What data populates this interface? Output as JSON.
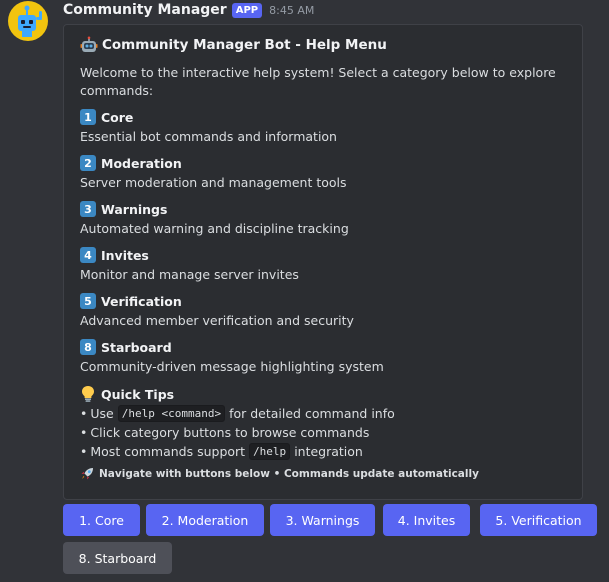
{
  "message": {
    "author": "Community Manager",
    "badge": "APP",
    "timestamp": "8:45 AM",
    "avatar_color": "#f1c40f"
  },
  "embed": {
    "title": "Community Manager Bot - Help Menu",
    "title_icon": "robot-icon",
    "description": "Welcome to the interactive help system! Select a category below to explore commands:",
    "categories": [
      {
        "key": "1",
        "name": "Core",
        "description": "Essential bot commands and information"
      },
      {
        "key": "2",
        "name": "Moderation",
        "description": "Server moderation and management tools"
      },
      {
        "key": "3",
        "name": "Warnings",
        "description": "Automated warning and discipline tracking"
      },
      {
        "key": "4",
        "name": "Invites",
        "description": "Monitor and manage server invites"
      },
      {
        "key": "5",
        "name": "Verification",
        "description": "Advanced member verification and security"
      },
      {
        "key": "8",
        "name": "Starboard",
        "description": "Community-driven message highlighting system"
      }
    ],
    "tips": {
      "heading": "Quick Tips",
      "icon": "lightbulb-icon",
      "items": [
        {
          "pre": "Use",
          "code": "/help <command>",
          "post": "for detailed command info"
        },
        {
          "pre": "Click category buttons to browse commands",
          "code": "",
          "post": ""
        },
        {
          "pre": "Most commands support",
          "code": "/help",
          "post": "integration"
        }
      ]
    },
    "footer": "Navigate with buttons below • Commands update automatically",
    "footer_icon": "rocket-icon"
  },
  "buttons": [
    {
      "label": "1. Core",
      "style": "primary"
    },
    {
      "label": "2. Moderation",
      "style": "primary"
    },
    {
      "label": "3. Warnings",
      "style": "primary"
    },
    {
      "label": "4. Invites",
      "style": "primary"
    },
    {
      "label": "5. Verification",
      "style": "primary"
    },
    {
      "label": "8. Starboard",
      "style": "secondary"
    }
  ],
  "colors": {
    "background": "#313338",
    "embed_background": "#2b2d31",
    "primary_button": "#5865f2",
    "secondary_button": "#4e5058",
    "keycap": "#3b88c3"
  }
}
